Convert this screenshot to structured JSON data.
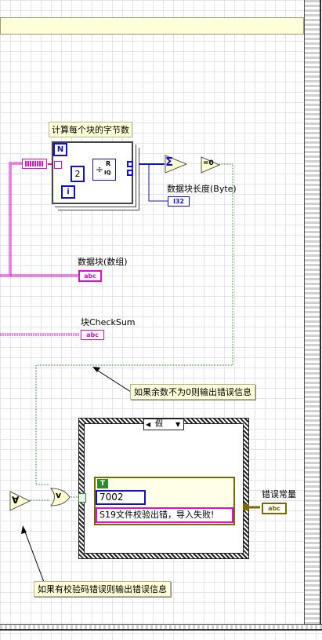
{
  "top_label": {
    "text": ""
  },
  "for_loop": {
    "label": "计算每个块的字节数",
    "count_terminal": "N",
    "index_terminal": "i",
    "divisor_constant": "2",
    "quotient_node": "÷",
    "quotient_out_r": "R",
    "quotient_out_iq": "IQ"
  },
  "sum_node": {
    "symbol": "Σ"
  },
  "equal_zero_node": {
    "symbol": "=0"
  },
  "block_length_indicator": {
    "label": "数据块长度(Byte)",
    "type": "I32"
  },
  "data_blocks_indicator": {
    "label": "数据块(数组)",
    "type": "abc"
  },
  "block_checksum_indicator": {
    "label": "块CheckSum",
    "type": "abc"
  },
  "comment_remainder": "如果余数不为0则输出错误信息",
  "comment_checksum": "如果有校验码错误则输出错误信息",
  "and_node": {
    "symbol": "∀"
  },
  "or_node": {
    "symbol": "v"
  },
  "case_structure": {
    "selector": "假",
    "left_arrow": "◀",
    "right_arrow": "▼"
  },
  "bundle": {
    "bool_const": "T",
    "code_const": "7002",
    "message_const": "S19文件校验出错，导入失败!"
  },
  "error_constant": {
    "label": "错误常量",
    "type": "abc"
  },
  "colors": {
    "boolean_wire": "#2e8b2e",
    "string_wire": "#e010d0",
    "numeric_wire": "#1010d0",
    "note_bg": "#ffffd8",
    "structure_border": "#303030"
  }
}
